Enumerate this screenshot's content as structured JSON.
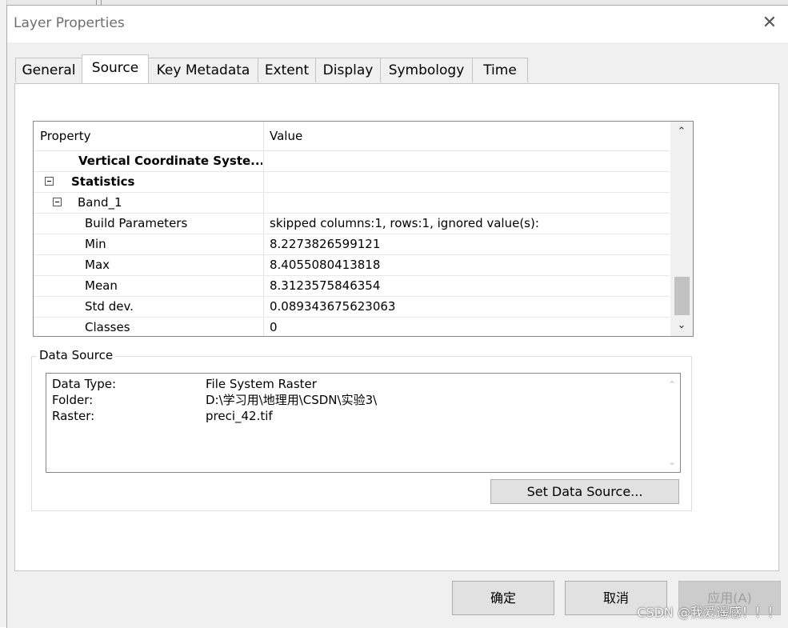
{
  "window": {
    "title": "Layer Properties",
    "close_glyph": "✕"
  },
  "tabs": [
    {
      "label": "General"
    },
    {
      "label": "Source"
    },
    {
      "label": "Key Metadata"
    },
    {
      "label": "Extent"
    },
    {
      "label": "Display"
    },
    {
      "label": "Symbology"
    },
    {
      "label": "Time"
    }
  ],
  "active_tab": "Source",
  "property_grid": {
    "headers": {
      "property": "Property",
      "value": "Value"
    },
    "rows": [
      {
        "property": "Vertical Coordinate Syste...",
        "value": ""
      },
      {
        "property": "Statistics",
        "value": ""
      },
      {
        "property": "Band_1",
        "value": ""
      },
      {
        "property": "Build Parameters",
        "value": "skipped columns:1, rows:1, ignored value(s):"
      },
      {
        "property": "Min",
        "value": "8.2273826599121"
      },
      {
        "property": "Max",
        "value": "8.4055080413818"
      },
      {
        "property": "Mean",
        "value": "8.3123575846354"
      },
      {
        "property": "Std dev.",
        "value": "0.089343675623063"
      },
      {
        "property": "Classes",
        "value": "0"
      }
    ],
    "scroll_up": "⌃",
    "scroll_down": "⌄"
  },
  "data_source": {
    "label": "Data Source",
    "items": [
      {
        "key": "Data Type:",
        "value": "File System Raster"
      },
      {
        "key": "Folder:",
        "value": "D:\\学习用\\地理用\\CSDN\\实验3\\"
      },
      {
        "key": "Raster:",
        "value": "preci_42.tif"
      }
    ],
    "set_button": "Set Data Source..."
  },
  "buttons": {
    "ok": "确定",
    "cancel": "取消",
    "apply": "应用(A)"
  },
  "watermark": "CSDN @我爱遥感！！！"
}
